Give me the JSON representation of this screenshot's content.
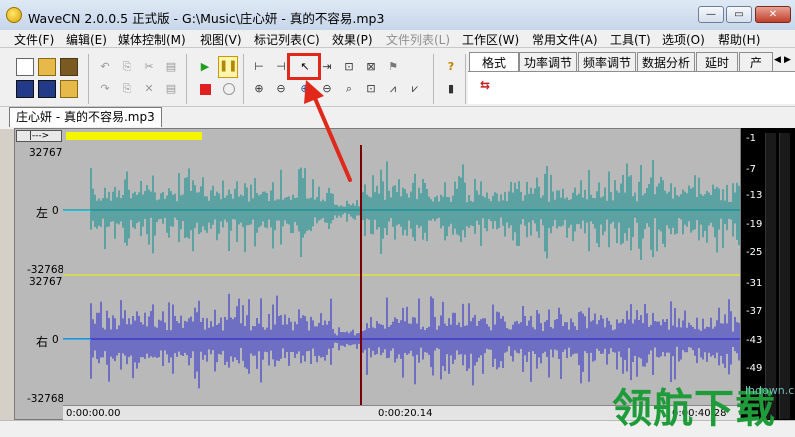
{
  "window": {
    "title": "WaveCN 2.0.0.5 正式版 - G:\\Music\\庄心妍 - 真的不容易.mp3",
    "minimize": "—",
    "maximize": "▭",
    "close": "✕"
  },
  "menu": [
    {
      "label": "文件(F)"
    },
    {
      "label": "编辑(E)"
    },
    {
      "label": "媒体控制(M)"
    },
    {
      "label": "视图(V)"
    },
    {
      "label": "标记列表(C)"
    },
    {
      "label": "效果(P)"
    },
    {
      "label": "文件列表(L)"
    },
    {
      "label": "工作区(W)"
    },
    {
      "label": "常用文件(A)"
    },
    {
      "label": "工具(T)"
    },
    {
      "label": "选项(O)"
    },
    {
      "label": "帮助(H)"
    }
  ],
  "right_tabs": [
    {
      "label": "格式"
    },
    {
      "label": "功率调节"
    },
    {
      "label": "频率调节"
    },
    {
      "label": "数据分析"
    },
    {
      "label": "延时"
    },
    {
      "label": "产"
    }
  ],
  "document_tab": "庄心妍 - 真的不容易.mp3",
  "scroll_button": "|--->",
  "channels": {
    "left": {
      "name": "左",
      "zero": "0",
      "max": "32767",
      "min": "-32768",
      "color": "#008b8b"
    },
    "right": {
      "name": "右",
      "zero": "0",
      "max": "32767",
      "min": "-32768",
      "color": "#2222cc"
    }
  },
  "timeline": {
    "start": "0:00:00.00",
    "mid": "0:00:20.14",
    "end": "0:00:40.28"
  },
  "db_scale": [
    "-1",
    "-7",
    "-13",
    "-19",
    "-25",
    "-31",
    "-37",
    "-43",
    "-49"
  ],
  "watermark": {
    "brand": "领航下载",
    "site": "lhdown.com"
  },
  "colors": {
    "highlight": "#e0291b",
    "playhead": "#7a0000",
    "divider": "#f5f500"
  }
}
